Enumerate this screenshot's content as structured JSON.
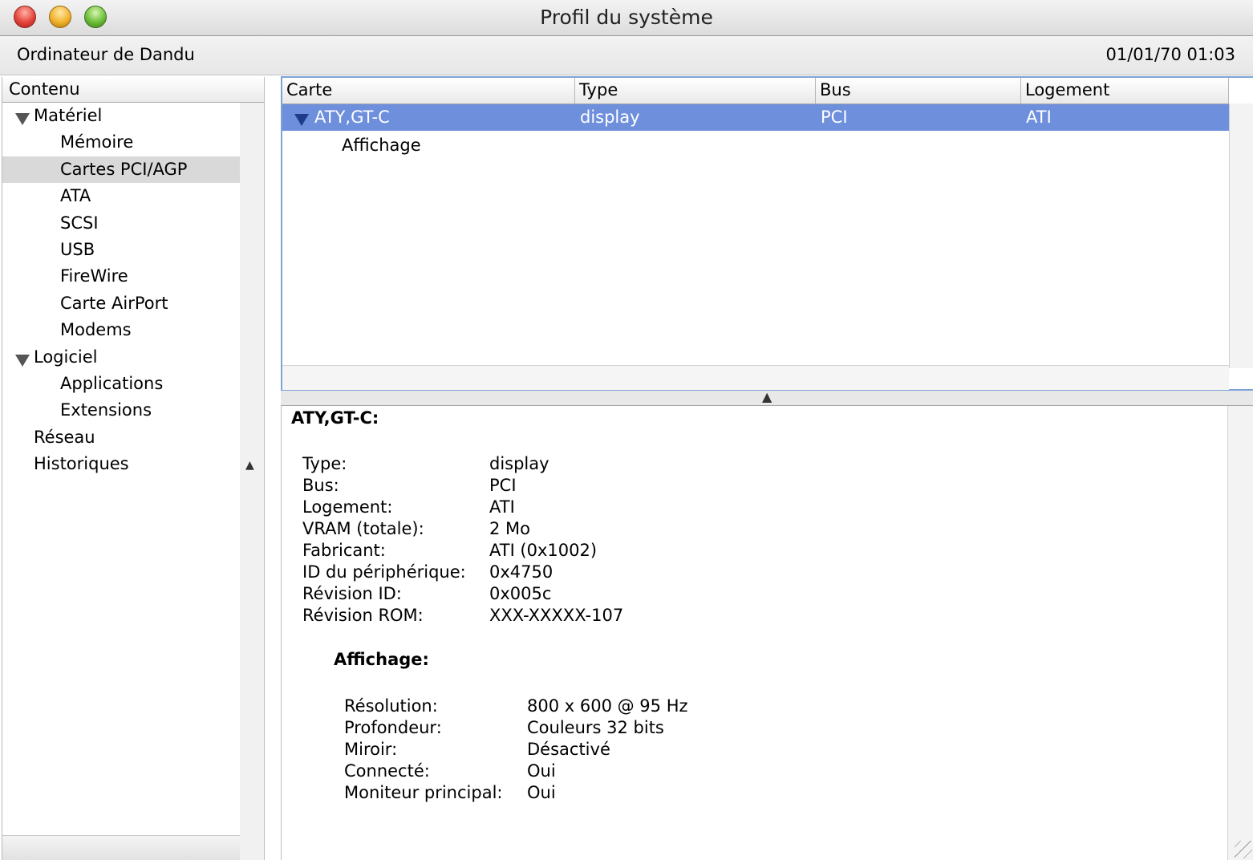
{
  "window": {
    "title": "Profil du système",
    "computer_name": "Ordinateur de Dandu",
    "datetime": "01/01/70 01:03"
  },
  "sidebar": {
    "header": "Contenu",
    "items": [
      {
        "label": "Matériel",
        "level": 0,
        "expanded": true
      },
      {
        "label": "Mémoire",
        "level": 1
      },
      {
        "label": "Cartes PCI/AGP",
        "level": 1,
        "selected": true
      },
      {
        "label": "ATA",
        "level": 1
      },
      {
        "label": "SCSI",
        "level": 1
      },
      {
        "label": "USB",
        "level": 1
      },
      {
        "label": "FireWire",
        "level": 1
      },
      {
        "label": "Carte AirPort",
        "level": 1
      },
      {
        "label": "Modems",
        "level": 1
      },
      {
        "label": "Logiciel",
        "level": 0,
        "expanded": true
      },
      {
        "label": "Applications",
        "level": 1
      },
      {
        "label": "Extensions",
        "level": 1
      },
      {
        "label": "Réseau",
        "level": 0
      },
      {
        "label": "Historiques",
        "level": 0
      }
    ]
  },
  "table": {
    "columns": [
      "Carte",
      "Type",
      "Bus",
      "Logement"
    ],
    "selected_row": {
      "carte": "ATY,GT-C",
      "type": "display",
      "bus": "PCI",
      "logement": "ATI"
    },
    "child_row": "Affichage"
  },
  "detail": {
    "title": "ATY,GT-C:",
    "fields": [
      {
        "key": "Type:",
        "value": "display"
      },
      {
        "key": "Bus:",
        "value": "PCI"
      },
      {
        "key": "Logement:",
        "value": "ATI"
      },
      {
        "key": "VRAM (totale):",
        "value": "2 Mo"
      },
      {
        "key": "Fabricant:",
        "value": "ATI (0x1002)"
      },
      {
        "key": "ID du périphérique:",
        "value": "0x4750"
      },
      {
        "key": "Révision ID:",
        "value": "0x005c"
      },
      {
        "key": "Révision ROM:",
        "value": "XXX-XXXXX-107"
      }
    ],
    "sub_title": "Affichage:",
    "sub_fields": [
      {
        "key": "Résolution:",
        "value": "800 x 600 @ 95 Hz"
      },
      {
        "key": "Profondeur:",
        "value": "Couleurs 32 bits"
      },
      {
        "key": "Miroir:",
        "value": "Désactivé"
      },
      {
        "key": "Connecté:",
        "value": "Oui"
      },
      {
        "key": "Moniteur principal:",
        "value": "Oui"
      }
    ]
  }
}
